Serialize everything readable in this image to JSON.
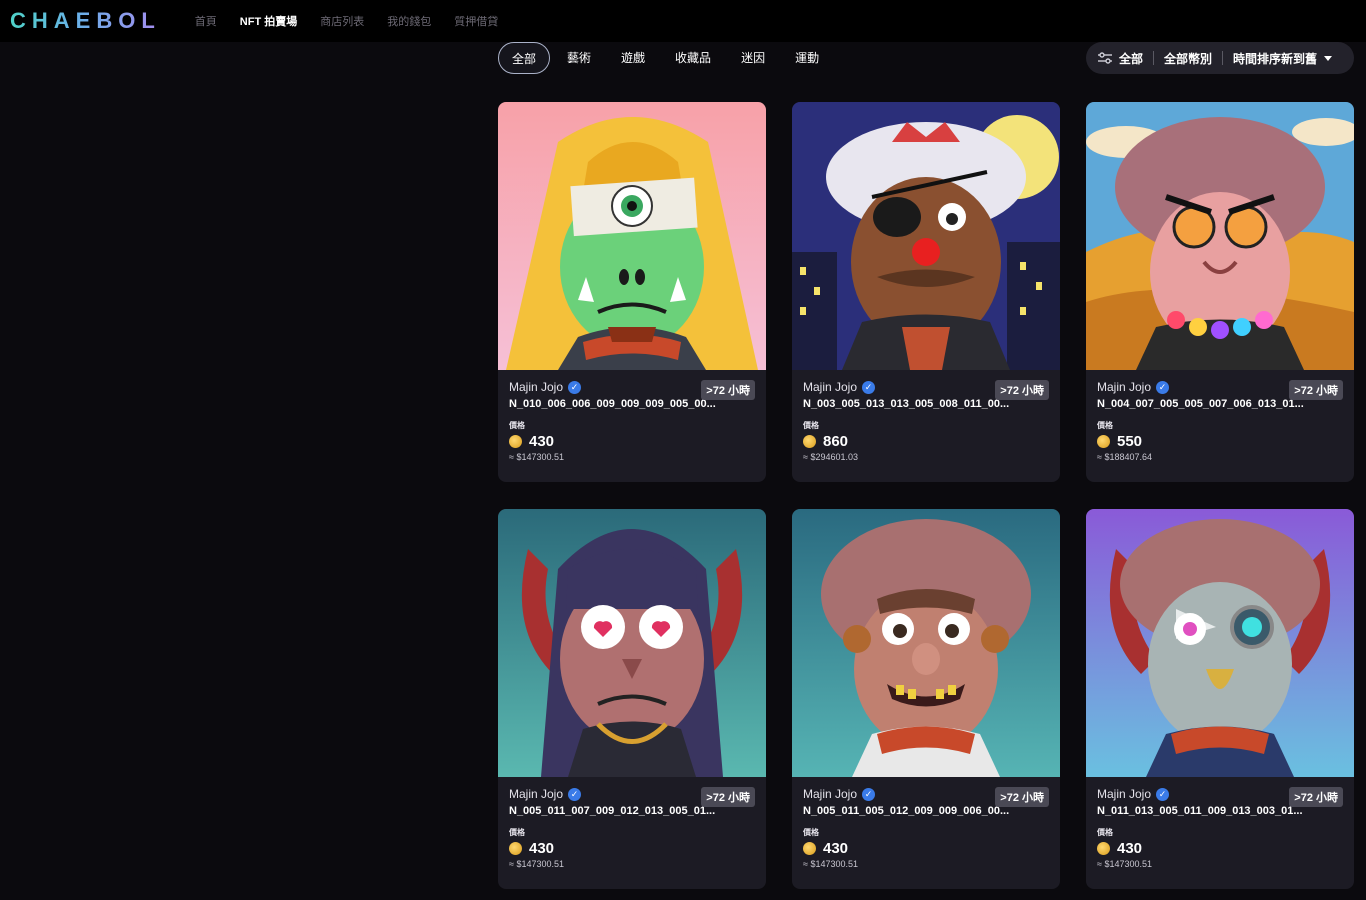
{
  "brand": {
    "logo_text": "CHAEBOL"
  },
  "nav": [
    {
      "label": "首頁",
      "active": false
    },
    {
      "label": "NFT 拍賣場",
      "active": true
    },
    {
      "label": "商店列表",
      "active": false
    },
    {
      "label": "我的錢包",
      "active": false
    },
    {
      "label": "質押借貸",
      "active": false
    }
  ],
  "filters": {
    "tabs": [
      {
        "label": "全部",
        "active": true
      },
      {
        "label": "藝術",
        "active": false
      },
      {
        "label": "遊戲",
        "active": false
      },
      {
        "label": "收藏品",
        "active": false
      },
      {
        "label": "迷因",
        "active": false
      },
      {
        "label": "運動",
        "active": false
      }
    ],
    "sort": {
      "icon": "sliders-icon",
      "all_label": "全部",
      "category_label": "全部幣別",
      "order_label": "時間排序新到舊"
    }
  },
  "cards": [
    {
      "creator": "Majin Jojo",
      "badge": ">72 小時",
      "token": "N_010_006_006_009_009_009_005_00...",
      "price_label": "價格",
      "price": "430",
      "usd": "≈ $147300.51",
      "theme": "cyclops"
    },
    {
      "creator": "Majin Jojo",
      "badge": ">72 小時",
      "token": "N_003_005_013_013_005_008_011_00...",
      "price_label": "價格",
      "price": "860",
      "usd": "≈ $294601.03",
      "theme": "pirate"
    },
    {
      "creator": "Majin Jojo",
      "badge": ">72 小時",
      "token": "N_004_007_005_005_007_006_013_01...",
      "price_label": "價格",
      "price": "550",
      "usd": "≈ $188407.64",
      "theme": "desert"
    },
    {
      "creator": "Majin Jojo",
      "badge": ">72 小時",
      "token": "N_005_011_007_009_012_013_005_01...",
      "price_label": "價格",
      "price": "430",
      "usd": "≈ $147300.51",
      "theme": "hearts"
    },
    {
      "creator": "Majin Jojo",
      "badge": ">72 小時",
      "token": "N_005_011_005_012_009_009_006_00...",
      "price_label": "價格",
      "price": "430",
      "usd": "≈ $147300.51",
      "theme": "curly"
    },
    {
      "creator": "Majin Jojo",
      "badge": ">72 小時",
      "token": "N_011_013_005_011_009_013_003_01...",
      "price_label": "價格",
      "price": "430",
      "usd": "≈ $147300.51",
      "theme": "cyborg"
    }
  ]
}
